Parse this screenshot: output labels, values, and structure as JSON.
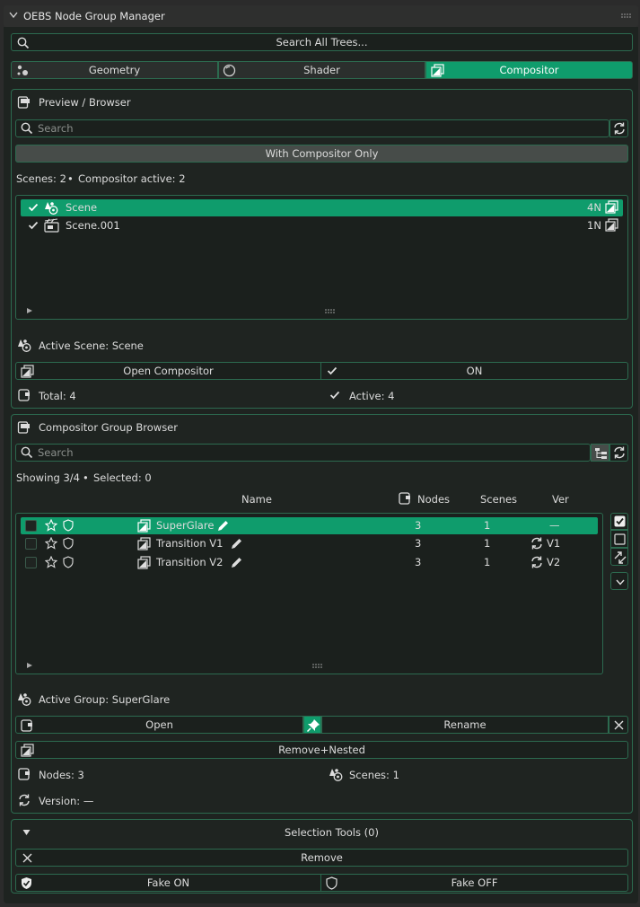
{
  "header": {
    "title": "OEBS Node Group Manager"
  },
  "search_all": {
    "label": "Search All Trees..."
  },
  "tree_tabs": [
    {
      "label": "Geometry",
      "icon": "geometry-nodes-icon"
    },
    {
      "label": "Shader",
      "icon": "shader-sphere-icon"
    },
    {
      "label": "Compositor",
      "icon": "compositor-icon"
    }
  ],
  "preview": {
    "title": "Preview / Browser",
    "search_placeholder": "Search",
    "filter_label": "With Compositor Only",
    "stats": {
      "scenes": "Scenes: 2",
      "bullet": "•",
      "compositor_active": "Compositor active: 2"
    },
    "scenes": [
      {
        "name": "Scene",
        "count": "4N",
        "selected": true
      },
      {
        "name": "Scene.001",
        "count": "1N",
        "selected": false
      }
    ],
    "active_scene": "Active Scene: Scene",
    "open_compositor": "Open Compositor",
    "on_label": "ON",
    "total": "Total: 4",
    "active": "Active: 4"
  },
  "group_browser": {
    "title": "Compositor Group Browser",
    "search_placeholder": "Search",
    "showing": "Showing 3/4",
    "bullet": "•",
    "selected": "Selected: 0",
    "columns": {
      "name": "Name",
      "nodes": "Nodes",
      "scenes": "Scenes",
      "ver": "Ver"
    },
    "groups": [
      {
        "name": "SuperGlare",
        "nodes": "3",
        "scenes": "1",
        "ver": "—",
        "selected": true
      },
      {
        "name": "Transition V1",
        "nodes": "3",
        "scenes": "1",
        "ver": "V1",
        "selected": false
      },
      {
        "name": "Transition V2",
        "nodes": "3",
        "scenes": "1",
        "ver": "V2",
        "selected": false
      }
    ],
    "active_group": "Active Group: SuperGlare",
    "open_label": "Open",
    "rename_label": "Rename",
    "remove_nested_label": "Remove+Nested",
    "nodes_info": "Nodes: 3",
    "scenes_info": "Scenes: 1",
    "version_info": "Version: —"
  },
  "selection_tools": {
    "title": "Selection Tools (0)",
    "remove_label": "Remove",
    "fake_on_label": "Fake ON",
    "fake_off_label": "Fake OFF"
  },
  "colors": {
    "accent": "#0f9c6c",
    "border": "#2c6a4f",
    "panel": "#1f2421",
    "background": "#2b2b2b"
  }
}
